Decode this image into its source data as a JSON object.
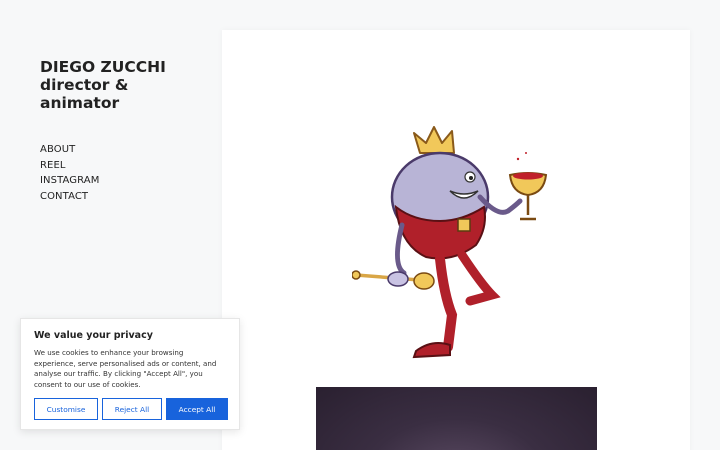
{
  "site": {
    "title_line1": "DIEGO ZUCCHI",
    "title_line2": "director &",
    "title_line3": "animator"
  },
  "nav": {
    "items": [
      {
        "label": "ABOUT"
      },
      {
        "label": "REEL"
      },
      {
        "label": "INSTAGRAM"
      },
      {
        "label": "CONTACT"
      }
    ]
  },
  "content": {
    "illustration_icon": "king-character-illustration",
    "video_icon": "video-thumbnail"
  },
  "cookie": {
    "title": "We value your privacy",
    "body": "We use cookies to enhance your browsing experience, serve personalised ads or content, and analyse our traffic. By clicking \"Accept All\", you consent to our use of cookies.",
    "customise_label": "Customise",
    "reject_label": "Reject All",
    "accept_label": "Accept All"
  },
  "colors": {
    "accent": "#1863dc",
    "background": "#f7f8f9",
    "text": "#222222"
  }
}
